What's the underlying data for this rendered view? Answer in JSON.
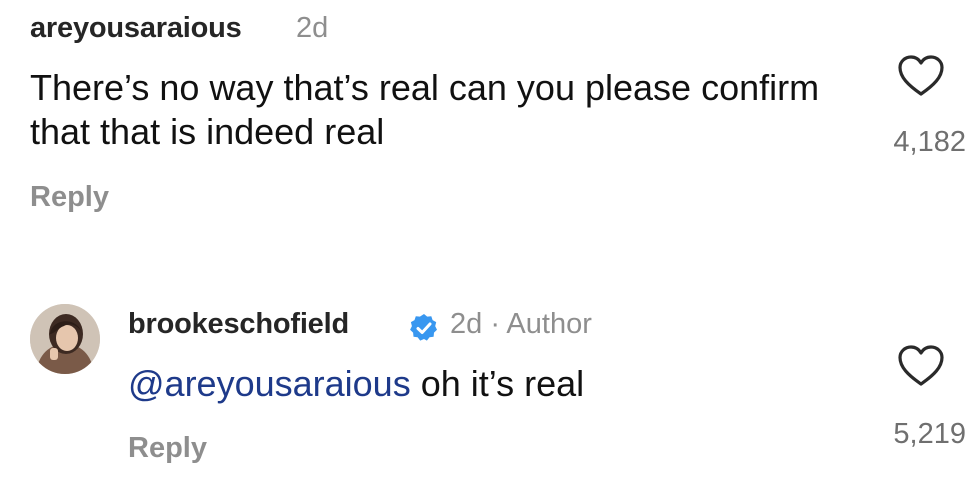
{
  "comments": [
    {
      "username": "areyousaraious",
      "time": "2d",
      "text": "There’s no way that’s real can you please confirm that that is indeed real",
      "reply_label": "Reply",
      "like_count": "4,182",
      "like_icon": "heart-outline"
    },
    {
      "username": "brookeschofield",
      "verified": true,
      "verified_icon": "verified-badge",
      "verified_color": "#3897f0",
      "meta": "2d · Author",
      "mention": "@areyousaraious",
      "text": " oh it’s real",
      "mention_color": "#1e3a8a",
      "reply_label": "Reply",
      "like_count": "5,219",
      "like_icon": "heart-outline",
      "avatar_icon": "profile-photo"
    }
  ],
  "colors": {
    "username": "#262626",
    "secondary_text": "#8e8e8e",
    "body_text": "#111111"
  }
}
